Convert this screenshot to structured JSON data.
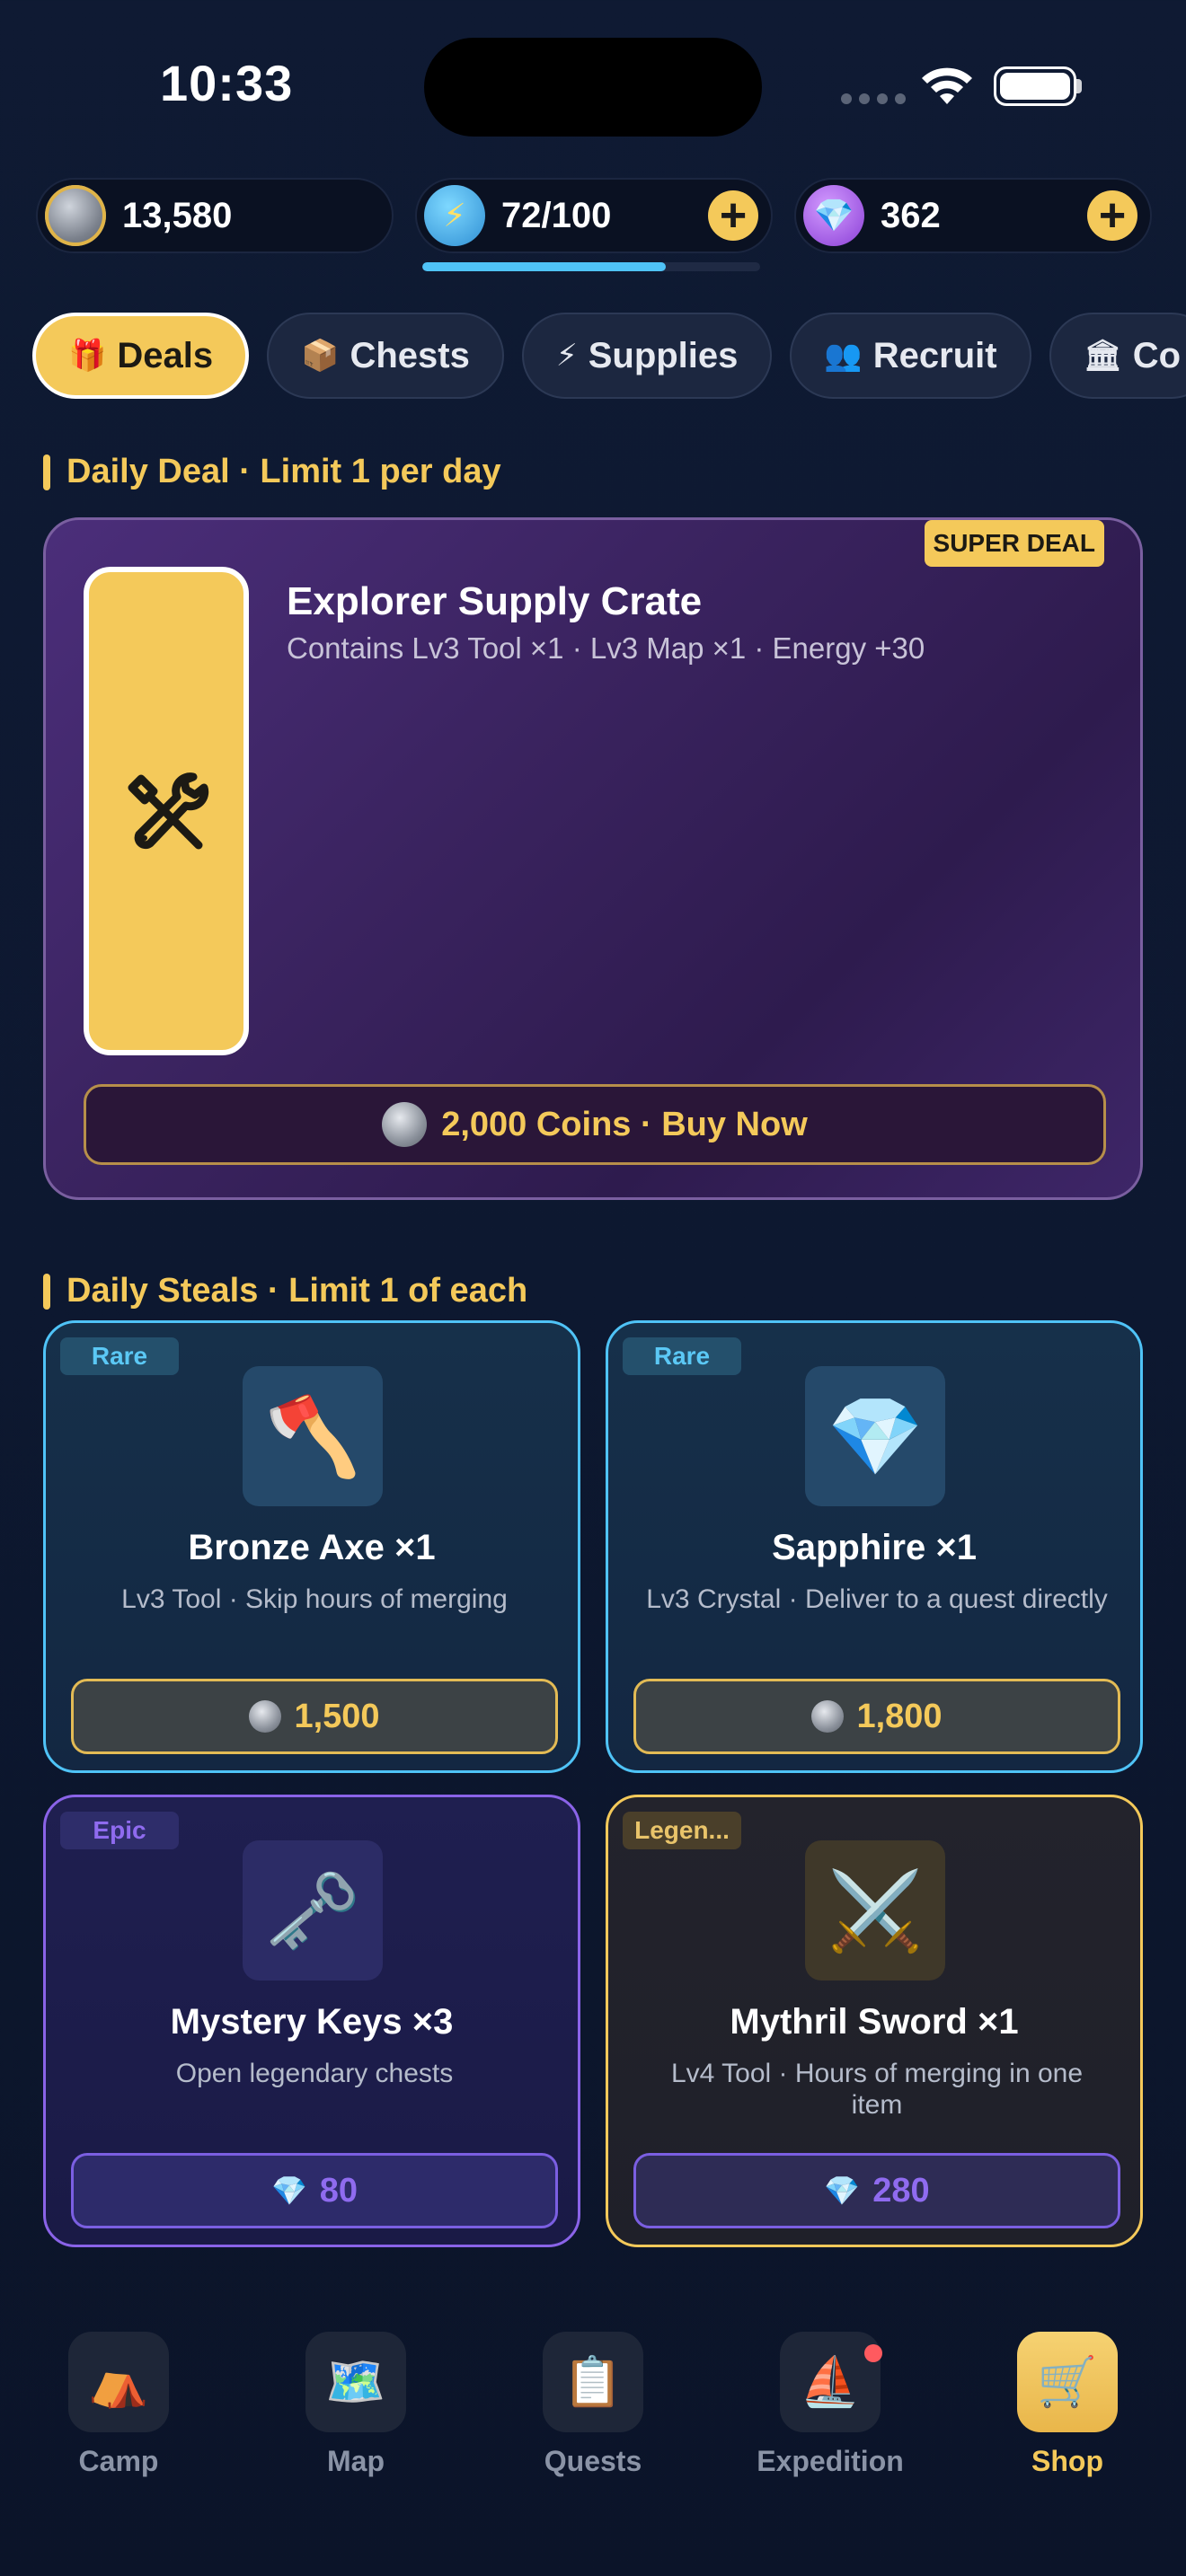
{
  "status": {
    "time": "10:33"
  },
  "currencies": {
    "coins": {
      "value": "13,580",
      "icon": "coin-icon"
    },
    "energy": {
      "value": "72/100",
      "progress": 0.72,
      "icon": "lightning-icon"
    },
    "gems": {
      "value": "362",
      "icon": "gem-icon"
    }
  },
  "tabs": [
    {
      "label": "Deals",
      "icon": "🎁",
      "active": true
    },
    {
      "label": "Chests",
      "icon": "📦"
    },
    {
      "label": "Supplies",
      "icon": "⚡"
    },
    {
      "label": "Recruit",
      "icon": "👥"
    },
    {
      "label": "Co",
      "icon": "🏛"
    }
  ],
  "daily_deal": {
    "section_title": "Daily Deal · Limit 1 per day",
    "badge": "SUPER DEAL",
    "title": "Explorer Supply Crate",
    "description": "Contains Lv3 Tool ×1 · Lv3 Map ×1 · Energy +30",
    "buy_label": "2,000 Coins · Buy Now"
  },
  "daily_steals": {
    "section_title": "Daily Steals · Limit 1 of each",
    "items": [
      {
        "rarity": "Rare",
        "icon": "🪓",
        "name": "Bronze Axe ×1",
        "description": "Lv3 Tool · Skip hours of merging",
        "price": "1,500",
        "currency": "coins"
      },
      {
        "rarity": "Rare",
        "icon": "💎",
        "name": "Sapphire ×1",
        "description": "Lv3 Crystal · Deliver to a quest directly",
        "price": "1,800",
        "currency": "coins"
      },
      {
        "rarity": "Epic",
        "icon": "🗝️",
        "name": "Mystery Keys ×3",
        "description": "Open legendary chests",
        "price": "80",
        "currency": "gems"
      },
      {
        "rarity": "Legen...",
        "icon": "⚔️",
        "name": "Mythril Sword ×1",
        "description": "Lv4 Tool · Hours of merging in one item",
        "price": "280",
        "currency": "gems"
      }
    ]
  },
  "nav": [
    {
      "label": "Camp",
      "icon": "⛺"
    },
    {
      "label": "Map",
      "icon": "🗺️"
    },
    {
      "label": "Quests",
      "icon": "📋"
    },
    {
      "label": "Expedition",
      "icon": "⛵",
      "notification": true
    },
    {
      "label": "Shop",
      "icon": "🛒",
      "active": true
    }
  ],
  "colors": {
    "accent": "#f4c95a",
    "rare": "#4fc3f7",
    "epic": "#8a63e8",
    "background": "#0f1a33"
  }
}
